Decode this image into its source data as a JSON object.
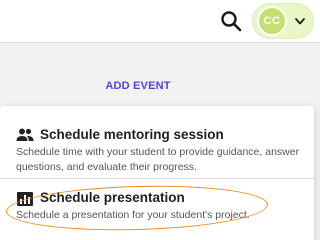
{
  "header": {
    "search_icon": "search-icon",
    "user": {
      "initials": "CC",
      "avatar_color": "#c5df72",
      "menu_icon": "chevron-down-icon"
    }
  },
  "main": {
    "add_event_label": "ADD EVENT",
    "accent_color": "#5a3fd9"
  },
  "dropdown": {
    "items": [
      {
        "icon": "people-icon",
        "title": "Schedule mentoring session",
        "description": "Schedule time with your student to provide guidance, answer questions, and evaluate their progress."
      },
      {
        "icon": "presentation-chart-icon",
        "title": "Schedule presentation",
        "description": "Schedule a presentation for your student's project."
      }
    ],
    "annotation_color": "#ef8a1c"
  }
}
